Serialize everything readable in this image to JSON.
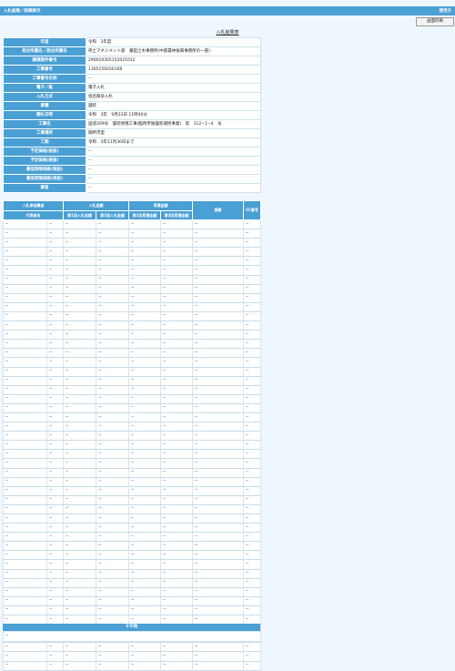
{
  "header": {
    "title": "入札結果／詳細表示",
    "help_label": "使用方"
  },
  "print_button": "画面印刷",
  "page_title": "入札結果表",
  "info_rows": [
    {
      "label": "年度",
      "value": "令和　3年度"
    },
    {
      "label": "発注所属名／発注所属名",
      "value": "県土マネジメント部　藁田土木事務所(中部農林振興事務所の一部)"
    },
    {
      "label": "調達案件番号",
      "value": "290010305152021012"
    },
    {
      "label": "工事番号",
      "value": "130515S030168"
    },
    {
      "label": "工事番号名称",
      "value": "--"
    },
    {
      "label": "電子／紙",
      "value": "電子入札"
    },
    {
      "label": "入札方式",
      "value": "指名競争入札"
    },
    {
      "label": "業種",
      "value": "舗装"
    },
    {
      "label": "開札日時",
      "value": "令和　3年　9月22日 11時40分"
    },
    {
      "label": "工事名",
      "value": "国道309号　舗装修繕工事(臨時単独舗装補修事業)　第　312−1−4　号"
    },
    {
      "label": "工事場所",
      "value": "御所市室"
    },
    {
      "label": "工期",
      "value": "令和　3年11月30日まで"
    },
    {
      "label": "予定価格(税抜)",
      "value": "--"
    },
    {
      "label": "予定価格(税抜)",
      "value": "--"
    },
    {
      "label": "最低制限価格(税抜)",
      "value": "--"
    },
    {
      "label": "最低制限価格(税抜)",
      "value": "--"
    },
    {
      "label": "業者",
      "value": "--"
    }
  ],
  "bid_table": {
    "group_headers": {
      "bidder": "入札参加業者",
      "bid_amount": "入札金額",
      "negotiation": "見積金額",
      "remarks": "摘要",
      "cc": "CC番号"
    },
    "sub_headers": {
      "name": "代表者名",
      "bid1": "第1回入札金額",
      "bid2": "第2回入札金額",
      "neg1": "第1回見積金額",
      "neg2": "第2回見積金額"
    },
    "rows": [
      [
        "--",
        "--",
        "--",
        "--",
        "--",
        "--",
        "--",
        "--"
      ],
      [
        "--",
        "--",
        "--",
        "--",
        "--",
        "--",
        "--",
        "--"
      ],
      [
        "--",
        "--",
        "--",
        "--",
        "--",
        "--",
        "--",
        "--"
      ],
      [
        "--",
        "--",
        "--",
        "--",
        "--",
        "--",
        "--",
        "--"
      ],
      [
        "--",
        "--",
        "--",
        "--",
        "--",
        "--",
        "--",
        "--"
      ],
      [
        "--",
        "--",
        "--",
        "--",
        "--",
        "--",
        "--",
        "--"
      ],
      [
        "--",
        "--",
        "--",
        "--",
        "--",
        "--",
        "--",
        "--"
      ],
      [
        "--",
        "--",
        "--",
        "--",
        "--",
        "--",
        "--",
        "--"
      ],
      [
        "--",
        "--",
        "--",
        "--",
        "--",
        "--",
        "--",
        "--"
      ],
      [
        "--",
        "--",
        "--",
        "--",
        "--",
        "--",
        "--",
        "--"
      ],
      [
        "--",
        "--",
        "--",
        "--",
        "--",
        "--",
        "--",
        "--"
      ],
      [
        "--",
        "--",
        "--",
        "--",
        "--",
        "--",
        "--",
        "--"
      ],
      [
        "--",
        "--",
        "--",
        "--",
        "--",
        "--",
        "--",
        "--"
      ],
      [
        "--",
        "--",
        "--",
        "--",
        "--",
        "--",
        "--",
        "--"
      ],
      [
        "--",
        "--",
        "--",
        "--",
        "--",
        "--",
        "--",
        "--"
      ],
      [
        "--",
        "--",
        "--",
        "--",
        "--",
        "--",
        "--",
        "--"
      ],
      [
        "--",
        "--",
        "--",
        "--",
        "--",
        "--",
        "--",
        "--"
      ],
      [
        "--",
        "--",
        "--",
        "--",
        "--",
        "--",
        "--",
        "--"
      ],
      [
        "--",
        "--",
        "--",
        "--",
        "--",
        "--",
        "--",
        "--"
      ],
      [
        "--",
        "--",
        "--",
        "--",
        "--",
        "--",
        "--",
        "--"
      ],
      [
        "--",
        "--",
        "--",
        "--",
        "--",
        "--",
        "--",
        "--"
      ],
      [
        "--",
        "--",
        "--",
        "--",
        "--",
        "--",
        "--",
        "--"
      ],
      [
        "--",
        "--",
        "--",
        "--",
        "--",
        "--",
        "--",
        "--"
      ],
      [
        "--",
        "--",
        "--",
        "--",
        "--",
        "--",
        "--",
        "--"
      ],
      [
        "--",
        "--",
        "--",
        "--",
        "--",
        "--",
        "--",
        "--"
      ],
      [
        "--",
        "--",
        "--",
        "--",
        "--",
        "--",
        "--",
        "--"
      ],
      [
        "--",
        "--",
        "--",
        "--",
        "--",
        "--",
        "--",
        "--"
      ],
      [
        "--",
        "--",
        "--",
        "--",
        "--",
        "--",
        "--",
        "--"
      ],
      [
        "--",
        "--",
        "--",
        "--",
        "--",
        "--",
        "--",
        "--"
      ],
      [
        "--",
        "--",
        "--",
        "--",
        "--",
        "--",
        "--",
        "--"
      ],
      [
        "--",
        "--",
        "--",
        "--",
        "--",
        "--",
        "--",
        "--"
      ],
      [
        "--",
        "--",
        "--",
        "--",
        "--",
        "--",
        "--",
        "--"
      ],
      [
        "--",
        "--",
        "--",
        "--",
        "--",
        "--",
        "--",
        "--"
      ],
      [
        "--",
        "--",
        "--",
        "--",
        "--",
        "--",
        "--",
        "--"
      ],
      [
        "--",
        "--",
        "--",
        "--",
        "--",
        "--",
        "--",
        "--"
      ],
      [
        "--",
        "--",
        "--",
        "--",
        "--",
        "--",
        "--",
        "--"
      ],
      [
        "--",
        "--",
        "--",
        "--",
        "--",
        "--",
        "--",
        "--"
      ],
      [
        "--",
        "--",
        "--",
        "--",
        "--",
        "--",
        "--",
        "--"
      ],
      [
        "--",
        "--",
        "--",
        "--",
        "--",
        "--",
        "--",
        "--"
      ],
      [
        "--",
        "--",
        "--",
        "--",
        "--",
        "--",
        "--",
        "--"
      ],
      [
        "--",
        "--",
        "--",
        "--",
        "--",
        "--",
        "--",
        "--"
      ],
      [
        "--",
        "--",
        "--",
        "--",
        "--",
        "--",
        "--",
        "--"
      ],
      [
        "--",
        "--",
        "--",
        "--",
        "--",
        "--",
        "--",
        "--"
      ],
      [
        "--",
        "--",
        "--",
        "--",
        "--",
        "--",
        "--",
        "--"
      ],
      [
        "--",
        "--",
        "--",
        "--",
        "--",
        "--",
        "--",
        "--"
      ],
      [
        "--",
        "--",
        "--",
        "--",
        "--",
        "--",
        "--",
        "--"
      ],
      [
        "--",
        "--",
        "--",
        "--",
        "--",
        "--",
        "--",
        "--"
      ],
      [
        "--",
        "--",
        "--",
        "--",
        "--",
        "--",
        "--",
        "--"
      ],
      [
        "--",
        "--",
        "--",
        "--",
        "--",
        "--",
        "--",
        "--"
      ]
    ]
  },
  "other": {
    "label": "その他",
    "value": "--"
  }
}
